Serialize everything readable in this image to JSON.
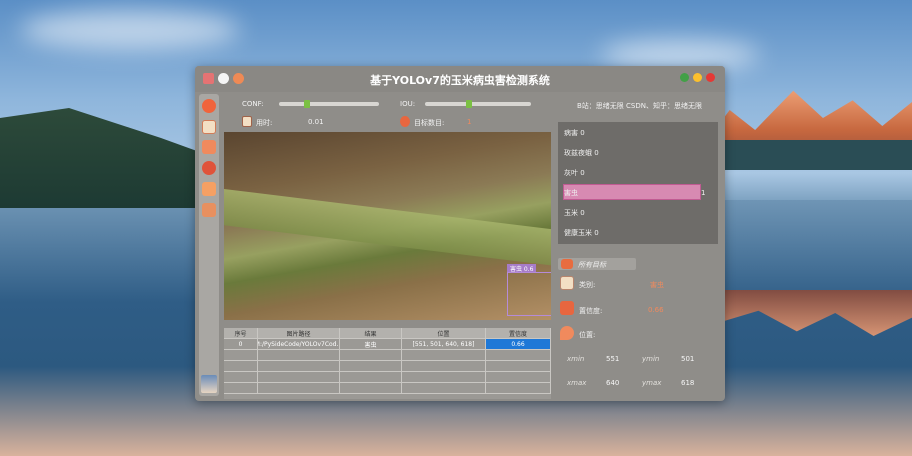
{
  "window": {
    "title": "基于YOLOv7的玉米病虫害检测系统"
  },
  "controls": {
    "conf_label": "CONF:",
    "conf_value": 0.27,
    "iou_label": "IOU:",
    "iou_value": 0.41,
    "time_label": "用时:",
    "time_value": "0.01",
    "count_label": "目标数目:",
    "count_value": "1"
  },
  "video": {
    "detection_label": "害虫  0.6"
  },
  "table": {
    "headers": [
      "序号",
      "图片路径",
      "结果",
      "位置",
      "置信度"
    ],
    "rows": [
      [
        "0",
        "M:/PySideCode/YOLOv7Cod...",
        "害虫",
        "[551, 501, 640, 618]",
        "0.66"
      ]
    ],
    "empty_rows": 4
  },
  "author": "B站：思绪无限 CSDN、知乎：思绪无限",
  "stats": [
    {
      "label": "病害",
      "count": "0",
      "highlight": false
    },
    {
      "label": "玫兹夜蛾",
      "count": "0",
      "highlight": false
    },
    {
      "label": "灰叶",
      "count": "0",
      "highlight": false
    },
    {
      "label": "害虫",
      "count": "1",
      "highlight": true
    },
    {
      "label": "玉米",
      "count": "0",
      "highlight": false
    },
    {
      "label": "健康玉米",
      "count": "0",
      "highlight": false
    }
  ],
  "detail": {
    "header": "所有目标",
    "category_label": "类别:",
    "category_value": "害虫",
    "confidence_label": "置信度:",
    "confidence_value": "0.66",
    "position_label": "位置:",
    "xmin_label": "xmin",
    "xmin": "551",
    "ymin_label": "ymin",
    "ymin": "501",
    "xmax_label": "xmax",
    "xmax": "640",
    "ymax_label": "ymax",
    "ymax": "618"
  },
  "colors": {
    "accent_green": "#7bc043",
    "highlight_pink": "#d78ab2",
    "label_orange": "#f08a5d",
    "window_close": "#e53935",
    "window_min": "#fbc02d",
    "window_max": "#43a047"
  }
}
